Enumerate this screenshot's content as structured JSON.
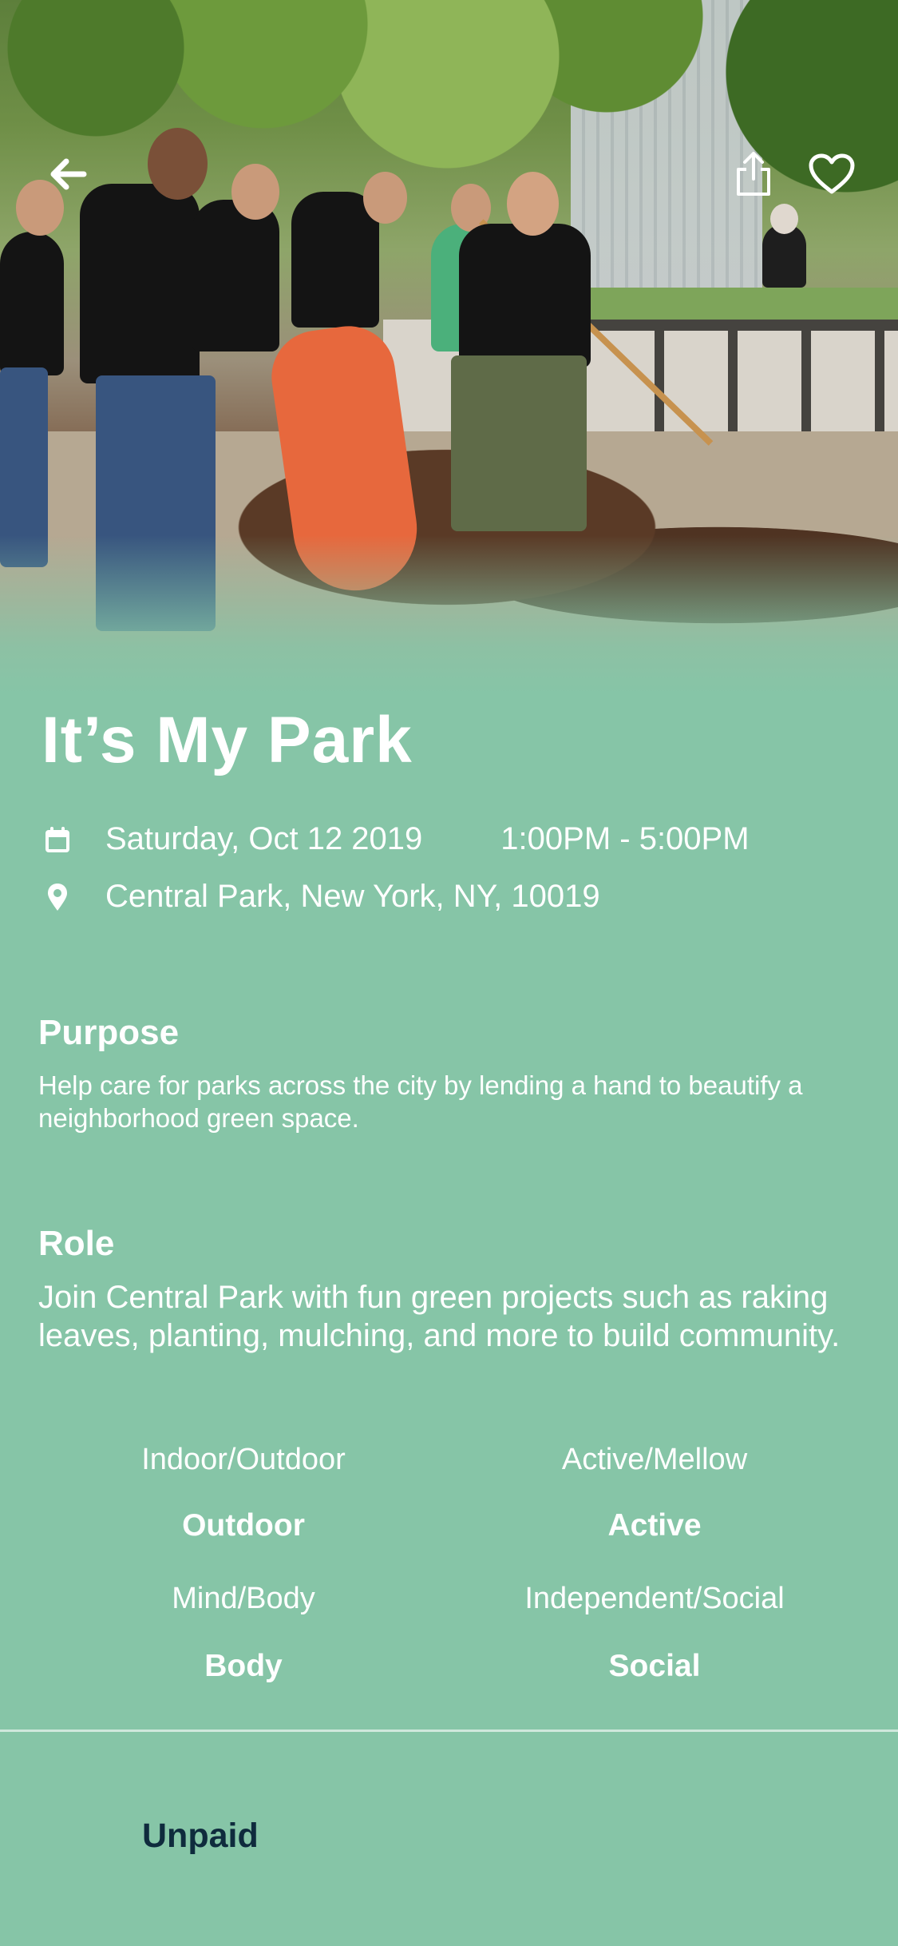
{
  "event": {
    "title": "It’s My Park",
    "date": "Saturday, Oct 12 2019",
    "time": "1:00PM - 5:00PM",
    "location": "Central Park, New York, NY, 10019"
  },
  "purpose": {
    "heading": "Purpose",
    "text": "Help care for parks across the city by lending a hand to beautify a neighborhood green space."
  },
  "role": {
    "heading": "Role",
    "text": "Join Central Park with fun green projects such as raking leaves, planting, mulching, and more to build community."
  },
  "attributes": [
    {
      "label": "Indoor/Outdoor",
      "value": "Outdoor"
    },
    {
      "label": "Active/Mellow",
      "value": "Active"
    },
    {
      "label": "Mind/Body",
      "value": "Body"
    },
    {
      "label": "Independent/Social",
      "value": "Social"
    }
  ],
  "compensation": "Unpaid",
  "icons": {
    "back": "back-arrow-icon",
    "share": "share-icon",
    "favorite": "heart-icon",
    "calendar": "calendar-icon",
    "location": "location-pin-icon"
  },
  "colors": {
    "background": "#86c5a7",
    "text": "#ffffff",
    "accent_text": "#0f2b3d"
  }
}
